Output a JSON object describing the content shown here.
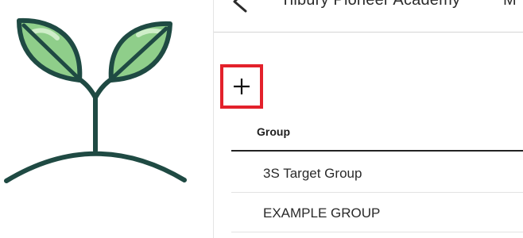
{
  "logo": {
    "icon": "sprout-icon",
    "colors": {
      "outline": "#1f4a43",
      "leaf": "#8fce8a",
      "leaf_highlight": "#cfeec9"
    }
  },
  "header": {
    "back_icon": "back-chevron-icon",
    "school_name": "Tilbury Pioneer Academy",
    "menu_label": "M"
  },
  "toolbar": {
    "add_icon": "plus-icon",
    "highlight_color": "#e3212b"
  },
  "table": {
    "columns": [
      "Group"
    ],
    "rows": [
      {
        "group": "3S Target Group"
      },
      {
        "group": "EXAMPLE GROUP"
      }
    ]
  }
}
